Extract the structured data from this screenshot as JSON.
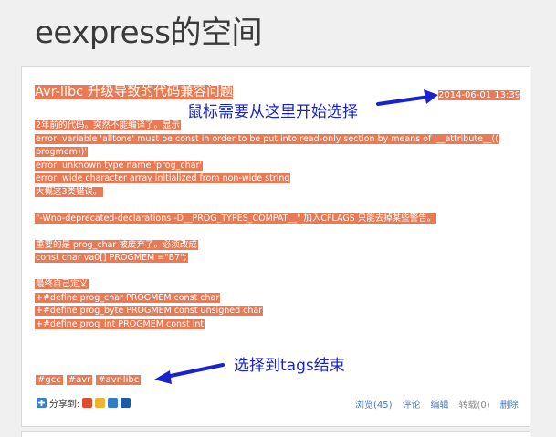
{
  "site": {
    "title": "eexpress的空间"
  },
  "post": {
    "title": "Avr-libc 升级导致的代码兼容问题",
    "date": "2014-06-01 13:39",
    "body_lines": [
      "2年前的代码。突然不能编译了。显示",
      "error: variable 'alltone' must be const in order to be put into read-only section by means of '__attribute__((",
      "progmem))'",
      "error: unknown type name 'prog_char'",
      "error: wide character array initialized from non-wide string",
      "大概这3类错误。",
      "",
      "\"-Wno-deprecated-declarations -D__PROG_TYPES_COMPAT__\" 加入CFLAGS 只能去掉某些警告。",
      "",
      "重要的是 prog_char 被废弃了。必须改成",
      "const char va0[] PROGMEM =\"B7\";",
      "",
      "最终自己定义",
      "+#define prog_char PROGMEM const char",
      "+#define prog_byte PROGMEM const unsigned char",
      "+#define prog_int PROGMEM const int"
    ],
    "tags": [
      "#gcc",
      "#avr",
      "#avr-libc"
    ]
  },
  "share": {
    "label": "分享到:",
    "icons": [
      "plus-share-icon",
      "weibo-icon",
      "qzone-icon",
      "renren-icon"
    ]
  },
  "actions": {
    "views": "浏览(45)",
    "comment": "评论",
    "edit": "编辑",
    "repost": "转载(0)",
    "delete": "删除"
  },
  "annotations": {
    "start": "鼠标需要从这里开始选择",
    "end": "选择到tags结束"
  },
  "colors": {
    "selection": "#e87b55",
    "annotation": "#1a23c9",
    "link": "#4a78b8"
  }
}
